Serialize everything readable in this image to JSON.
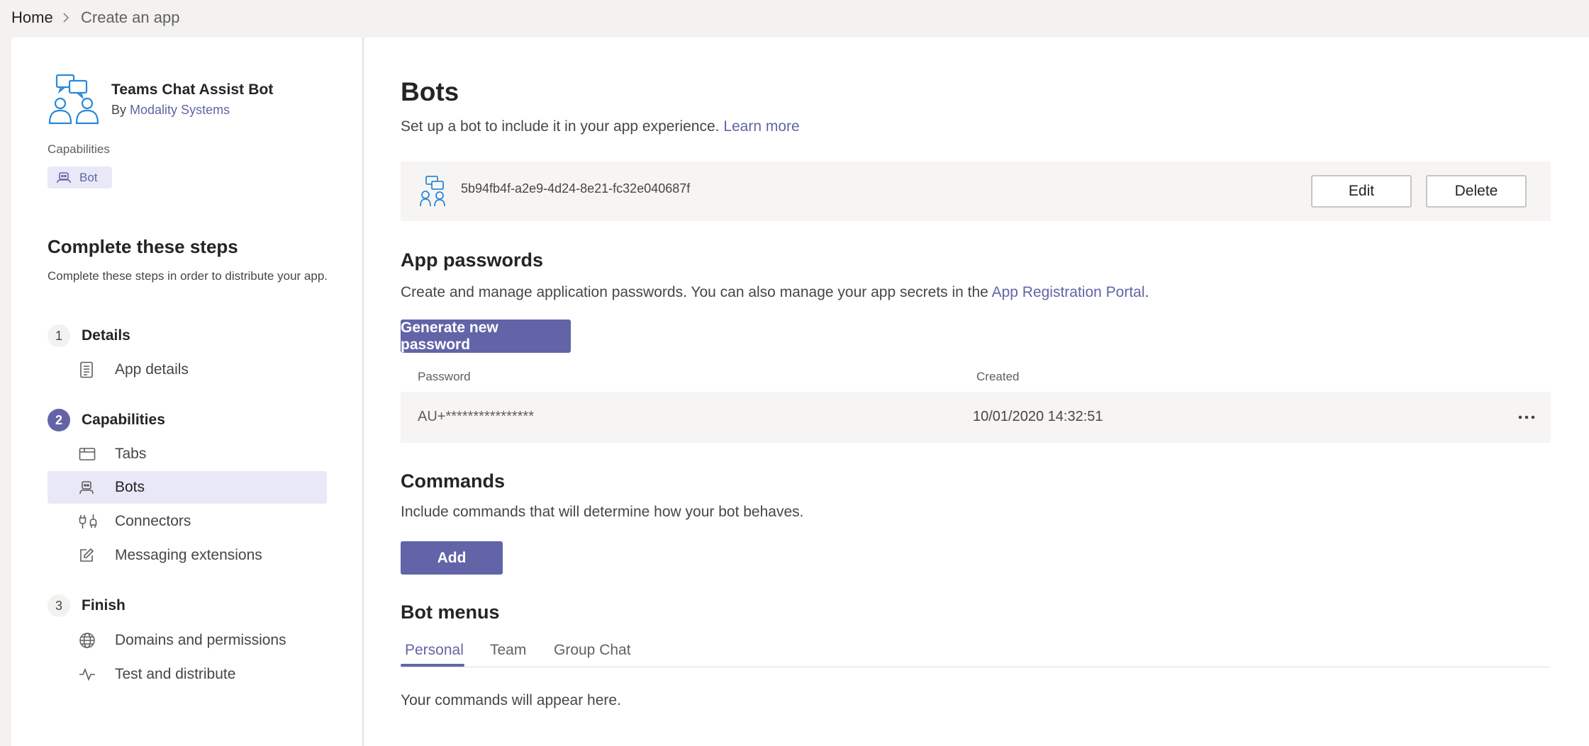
{
  "breadcrumb": {
    "home": "Home",
    "separator": ">",
    "current": "Create an app"
  },
  "app": {
    "name": "Teams Chat Assist Bot",
    "by_prefix": "By",
    "publisher": "Modality Systems",
    "capabilities_label": "Capabilities",
    "capability_badge": "Bot"
  },
  "steps": {
    "title": "Complete these steps",
    "description": "Complete these steps in order to distribute your app.",
    "groups": [
      {
        "number": "1",
        "title": "Details",
        "items": [
          {
            "label": "App details",
            "icon": "document-icon"
          }
        ]
      },
      {
        "number": "2",
        "title": "Capabilities",
        "items": [
          {
            "label": "Tabs",
            "icon": "tab-icon"
          },
          {
            "label": "Bots",
            "icon": "bot-icon"
          },
          {
            "label": "Connectors",
            "icon": "connector-icon"
          },
          {
            "label": "Messaging extensions",
            "icon": "edit-icon"
          }
        ]
      },
      {
        "number": "3",
        "title": "Finish",
        "items": [
          {
            "label": "Domains and permissions",
            "icon": "globe-icon"
          },
          {
            "label": "Test and distribute",
            "icon": "pulse-icon"
          }
        ]
      }
    ]
  },
  "main": {
    "title": "Bots",
    "subtitle": "Set up a bot to include it in your app experience.",
    "learn_more": "Learn more",
    "bot": {
      "id": "5b94fb4f-a2e9-4d24-8e21-fc32e040687f",
      "edit_label": "Edit",
      "delete_label": "Delete"
    },
    "app_passwords": {
      "title": "App passwords",
      "description": "Create and manage application passwords. You can also manage your app secrets in the",
      "portal_link": "App Registration Portal",
      "trailing": ".",
      "generate_label": "Generate new password",
      "columns": [
        "Password",
        "Created"
      ],
      "rows": [
        {
          "password": "AU+****************",
          "created": "10/01/2020 14:32:51"
        }
      ]
    },
    "commands": {
      "title": "Commands",
      "description": "Include commands that will determine how your bot behaves.",
      "add_label": "Add"
    },
    "bot_menus": {
      "title": "Bot menus",
      "tabs": [
        "Personal",
        "Team",
        "Group Chat"
      ],
      "active_tab": "Personal",
      "empty_text": "Your commands will appear here."
    }
  },
  "colors": {
    "accent": "#6264a7",
    "accent_light": "#e8e8f7",
    "icon_blue": "#2b88d8"
  }
}
